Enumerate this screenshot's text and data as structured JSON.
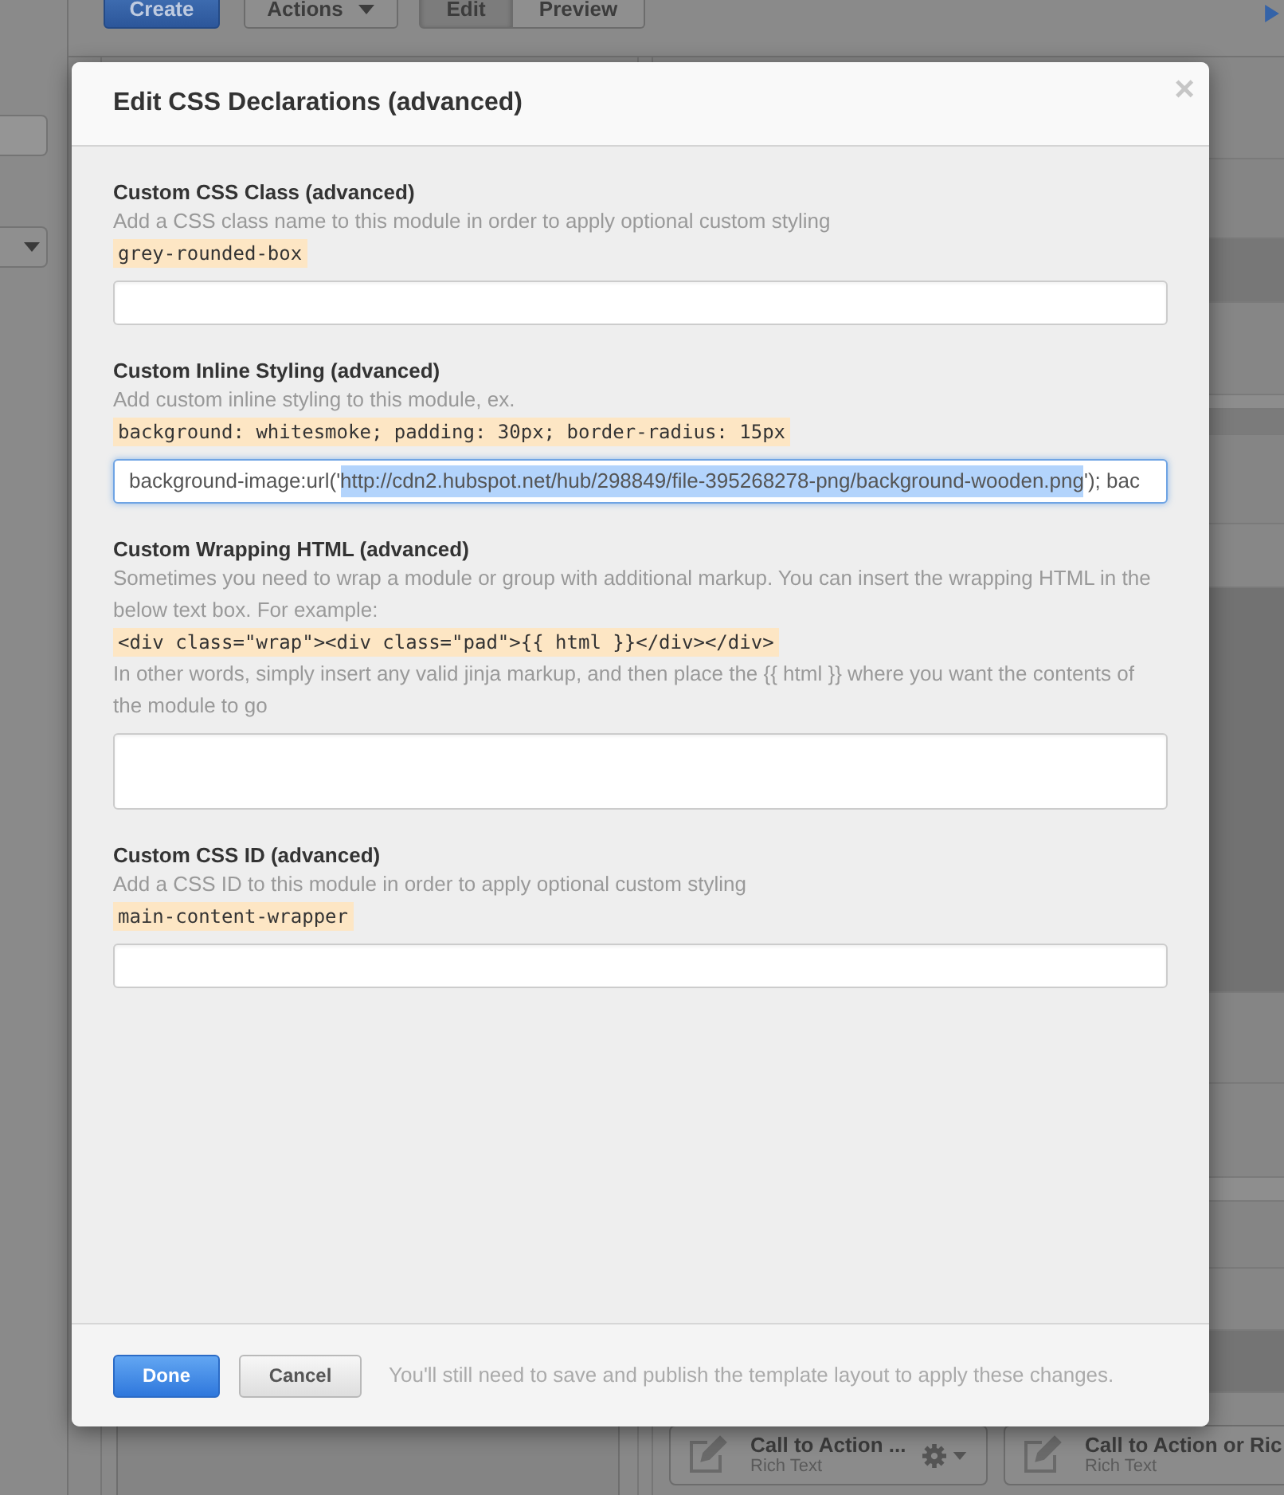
{
  "toolbar": {
    "create_button": "Create",
    "actions_menu": "Actions",
    "view_tabs": [
      {
        "label": "Edit",
        "selected": true
      },
      {
        "label": "Preview",
        "selected": false
      }
    ]
  },
  "modules": [
    {
      "title": "Call to Action ...",
      "type": "Rich Text",
      "menu": true
    },
    {
      "title": "Call to Action or Ric",
      "type": "Rich Text",
      "menu": false
    }
  ],
  "dialog": {
    "title": "Edit CSS Declarations (advanced)",
    "close": "×",
    "fields": [
      {
        "label": "Custom CSS Class (advanced)",
        "help": "Add a CSS class name to this module in order to apply optional custom styling",
        "example": "grey-rounded-box",
        "kind": "input",
        "focused": false
      },
      {
        "label": "Custom Inline Styling (advanced)",
        "help": "Add custom inline styling to this module, ex.",
        "example": "background: whitesmoke; padding: 30px; border-radius: 15px",
        "kind": "input",
        "focused": true,
        "value": [
          {
            "text": "background-image:url('",
            "selected": false
          },
          {
            "text": "http://cdn2.hubspot.net/hub/298849/file-395268278-png/background-wooden.png",
            "selected": true
          },
          {
            "text": "'); bac",
            "selected": false
          }
        ]
      },
      {
        "label": "Custom Wrapping HTML (advanced)",
        "help": "Sometimes you need to wrap a module or group with additional markup. You can insert the wrapping HTML in the below text box. For example:",
        "example": "<div class=\"wrap\"><div class=\"pad\">{{ html }}</div></div>",
        "note": "In other words, simply insert any valid jinja markup, and then place the {{ html }} where you want the contents of the module to go",
        "kind": "textarea",
        "focused": false
      },
      {
        "label": "Custom CSS ID (advanced)",
        "help": "Add a CSS ID to this module in order to apply optional custom styling",
        "example": "main-content-wrapper",
        "kind": "input",
        "focused": false
      }
    ],
    "buttons": [
      {
        "label": "Done",
        "kind": "primary"
      },
      {
        "label": "Cancel",
        "kind": "secondary"
      }
    ],
    "footer_note": "You'll still need to save and publish the template layout to apply these changes."
  }
}
